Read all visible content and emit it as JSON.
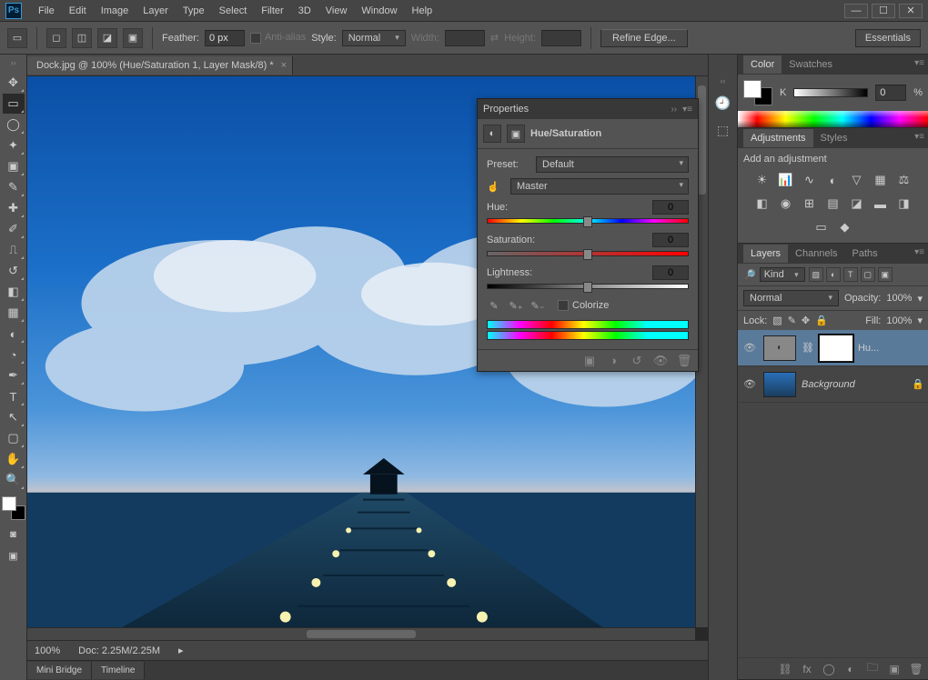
{
  "menubar": [
    "File",
    "Edit",
    "Image",
    "Layer",
    "Type",
    "Select",
    "Filter",
    "3D",
    "View",
    "Window",
    "Help"
  ],
  "optionsbar": {
    "feather_label": "Feather:",
    "feather_value": "0 px",
    "antialias": "Anti-alias",
    "style_label": "Style:",
    "style_value": "Normal",
    "width_label": "Width:",
    "height_label": "Height:",
    "refine": "Refine Edge...",
    "essentials": "Essentials"
  },
  "document": {
    "tab_title": "Dock.jpg @ 100% (Hue/Saturation 1, Layer Mask/8) *",
    "zoom": "100%",
    "docinfo": "Doc: 2.25M/2.25M"
  },
  "bottom_tabs": [
    "Mini Bridge",
    "Timeline"
  ],
  "properties": {
    "panel": "Properties",
    "title": "Hue/Saturation",
    "preset_label": "Preset:",
    "preset_value": "Default",
    "range": "Master",
    "hue_label": "Hue:",
    "hue_value": "0",
    "sat_label": "Saturation:",
    "sat_value": "0",
    "light_label": "Lightness:",
    "light_value": "0",
    "colorize": "Colorize"
  },
  "color_panel": {
    "tabs": [
      "Color",
      "Swatches"
    ],
    "k_label": "K",
    "k_value": "0",
    "k_unit": "%"
  },
  "adjustments_panel": {
    "tabs": [
      "Adjustments",
      "Styles"
    ],
    "heading": "Add an adjustment"
  },
  "layers_panel": {
    "tabs": [
      "Layers",
      "Channels",
      "Paths"
    ],
    "kind": "Kind",
    "blend": "Normal",
    "opacity_label": "Opacity:",
    "opacity": "100%",
    "lock_label": "Lock:",
    "fill_label": "Fill:",
    "fill": "100%",
    "layers": [
      {
        "name": "Hu...",
        "type": "adjustment",
        "visible": true,
        "selected": true
      },
      {
        "name": "Background",
        "type": "image",
        "visible": true,
        "locked": true
      }
    ]
  }
}
